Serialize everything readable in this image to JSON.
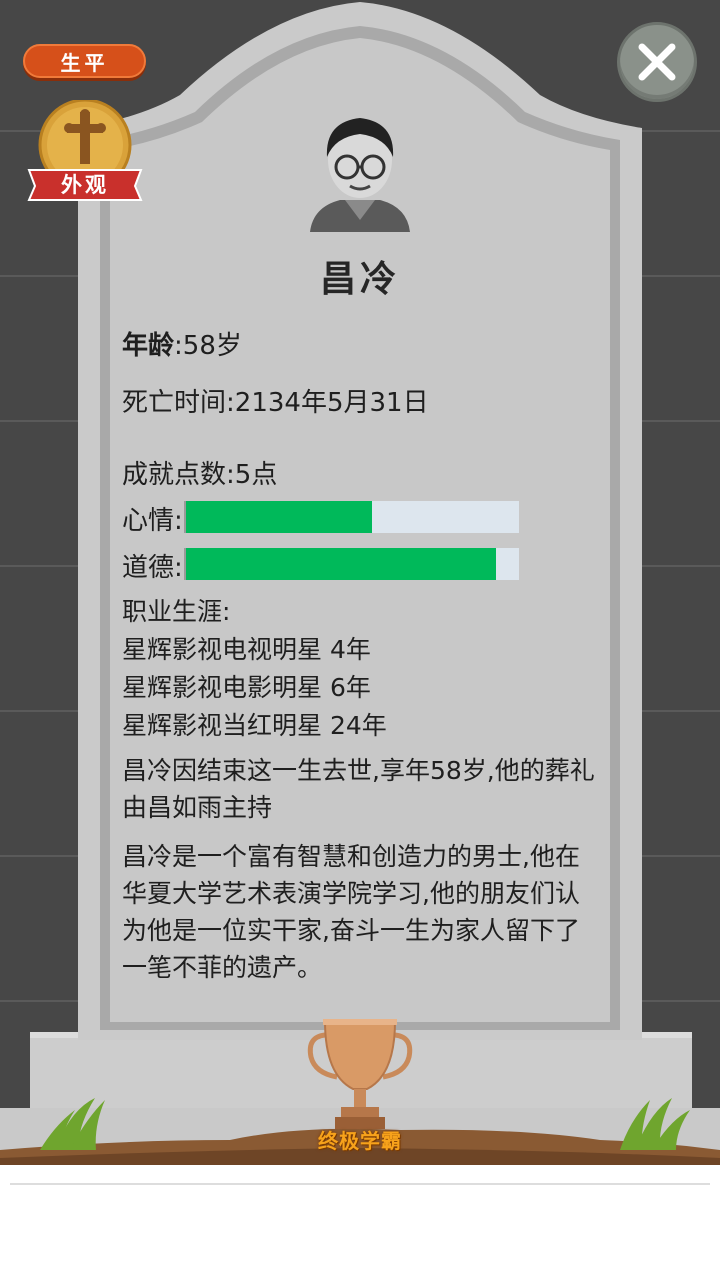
{
  "top": {
    "life_label": "生平",
    "look_label": "外观"
  },
  "profile": {
    "name": "昌冷"
  },
  "stats": {
    "age_label": "年龄",
    "age_value": ":58岁",
    "death_label": "死亡时间",
    "death_value": ":2134年5月31日",
    "achievement_label": "成就点数",
    "achievement_value": ":5点",
    "mood_label": "心情:",
    "mood_level": 0.56,
    "morality_label": "道德:",
    "morality_level": 0.93
  },
  "career": {
    "title": "职业生涯:",
    "items": [
      {
        "label": "星辉影视电视明星",
        "years": "4年"
      },
      {
        "label": "星辉影视电影明星",
        "years": "6年"
      },
      {
        "label": "星辉影视当红明星",
        "years": "24年"
      }
    ]
  },
  "obituary": {
    "funeral": "昌冷因结束这一生去世,享年58岁,他的葬礼由昌如雨主持",
    "bio": "昌冷是一个富有智慧和创造力的男士,他在华夏大学艺术表演学院学习,他的朋友们认为他是一位实干家,奋斗一生为家人留下了一笔不菲的遗产。"
  },
  "trophy": {
    "title": "终极学霸"
  },
  "colors": {
    "bar_fill": "#00b95a",
    "bar_track": "#dde6ee",
    "life_button": "#d6501a",
    "stone": "#c8c8c8"
  },
  "icons": {
    "close": "close-icon",
    "cross": "cross-icon",
    "trophy": "trophy-icon"
  }
}
